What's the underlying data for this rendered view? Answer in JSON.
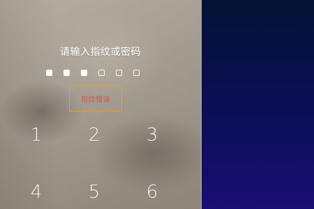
{
  "lock_screen": {
    "prompt_text": "请输入指纹或密码",
    "pin": {
      "max_length": 6,
      "entered_length": 3
    },
    "error_message": "指纹错误",
    "keypad": {
      "keys": [
        "1",
        "2",
        "3",
        "4",
        "5",
        "6"
      ]
    }
  },
  "theme": {
    "error_border_color": "#f0a11a",
    "error_text_color": "#e63b3b",
    "right_panel_gradient": [
      "#061334",
      "#0b0f59",
      "#1a0d74"
    ]
  }
}
